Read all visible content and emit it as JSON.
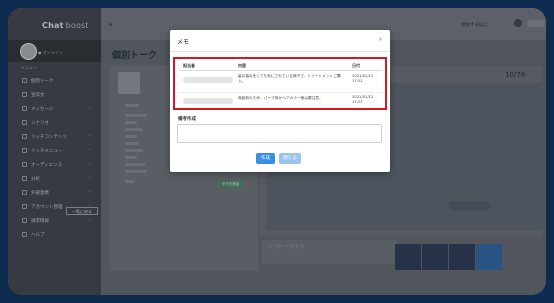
{
  "app": {
    "brand": "Chat",
    "brand_sub": "boost"
  },
  "sidebar": {
    "status": "● オンライン",
    "menu_label": "メニュー",
    "items": [
      {
        "label": "個別トーク",
        "has_chevron": false
      },
      {
        "label": "宣伝文",
        "has_chevron": false
      },
      {
        "label": "メッセージ",
        "has_chevron": true
      },
      {
        "label": "シナリオ",
        "has_chevron": false
      },
      {
        "label": "リッチコンテンツ",
        "has_chevron": true
      },
      {
        "label": "リッチメニュー",
        "has_chevron": true
      },
      {
        "label": "オーディエンス",
        "has_chevron": true
      },
      {
        "label": "分析",
        "has_chevron": true
      },
      {
        "label": "外部連携",
        "has_chevron": true
      },
      {
        "label": "アカウント管理",
        "has_chevron": true
      },
      {
        "label": "請求情報",
        "has_chevron": true
      },
      {
        "label": "ヘルプ",
        "has_chevron": false
      }
    ]
  },
  "topbar": {
    "hamburger": "≡",
    "right_text": "登録するはじ"
  },
  "page": {
    "title": "個別トーク",
    "counter": "10/76",
    "message_placeholder": "メッセージを入力",
    "back_button": "一覧に戻る",
    "tag_button": "タグを追加"
  },
  "modal": {
    "title": "メモ",
    "close": "×",
    "columns": [
      "担当者",
      "内容",
      "日付"
    ],
    "rows": [
      {
        "content": "髪の傷みをとても気にされている様子で、トリートメントご購入。",
        "date": "2021/02/12 17:32"
      },
      {
        "content": "商談前のため、パーマ後かヘアカラー無は要注意。",
        "date": "2021/02/12 17:23"
      }
    ],
    "note_label": "備考作成",
    "create_button": "作成",
    "close_button": "閉じる"
  },
  "colors": {
    "highlight": "#d01a22",
    "primary": "#3a8ee6",
    "sidebar": "#3f444b"
  }
}
